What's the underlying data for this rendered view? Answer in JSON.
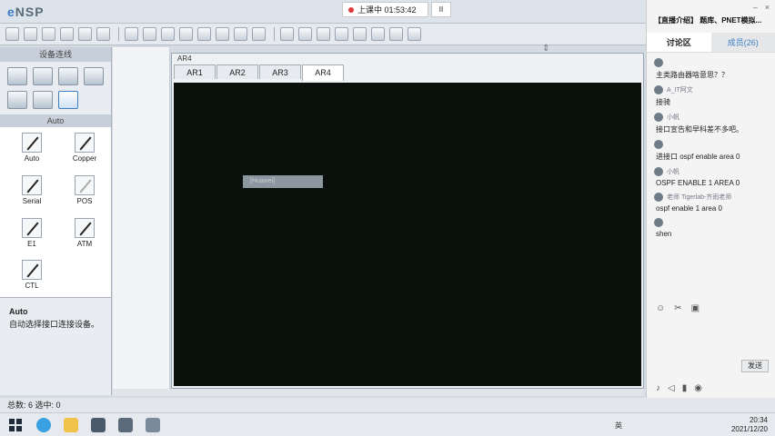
{
  "app": {
    "logo_prefix": "e",
    "logo_text": "NSP"
  },
  "recording": {
    "status": "上课中 01:53:42",
    "control": "II"
  },
  "left_panel": {
    "device_header": "设备连线",
    "cable_header": "Auto",
    "cables": [
      {
        "label": "Auto"
      },
      {
        "label": "Copper"
      },
      {
        "label": "Serial"
      },
      {
        "label": "POS"
      },
      {
        "label": "E1"
      },
      {
        "label": "ATM"
      },
      {
        "label": "CTL"
      }
    ],
    "desc_title": "Auto",
    "desc_text": "自动选择接口连接设备。"
  },
  "console": {
    "window_title": "AR4",
    "tabs": [
      "AR1",
      "AR2",
      "AR3",
      "AR4"
    ],
    "active_tab": "AR4",
    "selected_text": "[Huawei]"
  },
  "statusbar": {
    "text": "总数: 6 选中: 0"
  },
  "chat": {
    "top_icons": [
      "–",
      "×"
    ],
    "title": "【直播介绍】 题库、PNET模拟...",
    "tab_discussion": "讨论区",
    "tab_members": "成员(26)",
    "messages": [
      {
        "user": "",
        "text": "主类路由器啥意思？？"
      },
      {
        "user": "A_IT阿文",
        "text": "接骑"
      },
      {
        "user": "小帆",
        "text": "接口宣告和早科差不多吧。"
      },
      {
        "user": "",
        "text": "进接口 ospf enable area 0"
      },
      {
        "user": "小帆",
        "text": "OSPF ENABLE 1 AREA 0"
      },
      {
        "user": "老师 Tigerlab-齐雨老师",
        "text": "ospf enable 1 area 0"
      },
      {
        "user": "",
        "text": "shen"
      }
    ],
    "send_label": "发送"
  },
  "taskbar": {
    "time": "20:34",
    "date": "2021/12/20",
    "tray": "英"
  }
}
